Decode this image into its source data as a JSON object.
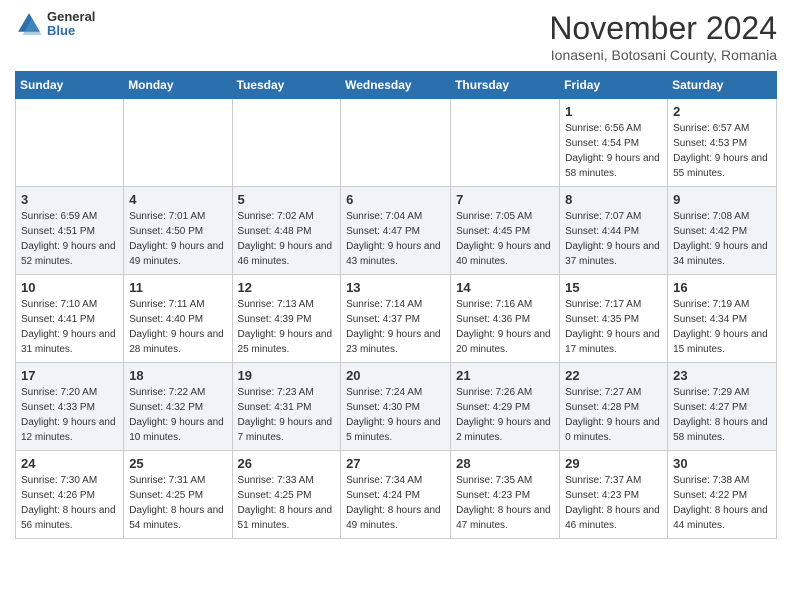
{
  "header": {
    "logo_general": "General",
    "logo_blue": "Blue",
    "month_title": "November 2024",
    "location": "Ionaseni, Botosani County, Romania"
  },
  "days_of_week": [
    "Sunday",
    "Monday",
    "Tuesday",
    "Wednesday",
    "Thursday",
    "Friday",
    "Saturday"
  ],
  "weeks": [
    [
      {
        "day": "",
        "info": ""
      },
      {
        "day": "",
        "info": ""
      },
      {
        "day": "",
        "info": ""
      },
      {
        "day": "",
        "info": ""
      },
      {
        "day": "",
        "info": ""
      },
      {
        "day": "1",
        "info": "Sunrise: 6:56 AM\nSunset: 4:54 PM\nDaylight: 9 hours and 58 minutes."
      },
      {
        "day": "2",
        "info": "Sunrise: 6:57 AM\nSunset: 4:53 PM\nDaylight: 9 hours and 55 minutes."
      }
    ],
    [
      {
        "day": "3",
        "info": "Sunrise: 6:59 AM\nSunset: 4:51 PM\nDaylight: 9 hours and 52 minutes."
      },
      {
        "day": "4",
        "info": "Sunrise: 7:01 AM\nSunset: 4:50 PM\nDaylight: 9 hours and 49 minutes."
      },
      {
        "day": "5",
        "info": "Sunrise: 7:02 AM\nSunset: 4:48 PM\nDaylight: 9 hours and 46 minutes."
      },
      {
        "day": "6",
        "info": "Sunrise: 7:04 AM\nSunset: 4:47 PM\nDaylight: 9 hours and 43 minutes."
      },
      {
        "day": "7",
        "info": "Sunrise: 7:05 AM\nSunset: 4:45 PM\nDaylight: 9 hours and 40 minutes."
      },
      {
        "day": "8",
        "info": "Sunrise: 7:07 AM\nSunset: 4:44 PM\nDaylight: 9 hours and 37 minutes."
      },
      {
        "day": "9",
        "info": "Sunrise: 7:08 AM\nSunset: 4:42 PM\nDaylight: 9 hours and 34 minutes."
      }
    ],
    [
      {
        "day": "10",
        "info": "Sunrise: 7:10 AM\nSunset: 4:41 PM\nDaylight: 9 hours and 31 minutes."
      },
      {
        "day": "11",
        "info": "Sunrise: 7:11 AM\nSunset: 4:40 PM\nDaylight: 9 hours and 28 minutes."
      },
      {
        "day": "12",
        "info": "Sunrise: 7:13 AM\nSunset: 4:39 PM\nDaylight: 9 hours and 25 minutes."
      },
      {
        "day": "13",
        "info": "Sunrise: 7:14 AM\nSunset: 4:37 PM\nDaylight: 9 hours and 23 minutes."
      },
      {
        "day": "14",
        "info": "Sunrise: 7:16 AM\nSunset: 4:36 PM\nDaylight: 9 hours and 20 minutes."
      },
      {
        "day": "15",
        "info": "Sunrise: 7:17 AM\nSunset: 4:35 PM\nDaylight: 9 hours and 17 minutes."
      },
      {
        "day": "16",
        "info": "Sunrise: 7:19 AM\nSunset: 4:34 PM\nDaylight: 9 hours and 15 minutes."
      }
    ],
    [
      {
        "day": "17",
        "info": "Sunrise: 7:20 AM\nSunset: 4:33 PM\nDaylight: 9 hours and 12 minutes."
      },
      {
        "day": "18",
        "info": "Sunrise: 7:22 AM\nSunset: 4:32 PM\nDaylight: 9 hours and 10 minutes."
      },
      {
        "day": "19",
        "info": "Sunrise: 7:23 AM\nSunset: 4:31 PM\nDaylight: 9 hours and 7 minutes."
      },
      {
        "day": "20",
        "info": "Sunrise: 7:24 AM\nSunset: 4:30 PM\nDaylight: 9 hours and 5 minutes."
      },
      {
        "day": "21",
        "info": "Sunrise: 7:26 AM\nSunset: 4:29 PM\nDaylight: 9 hours and 2 minutes."
      },
      {
        "day": "22",
        "info": "Sunrise: 7:27 AM\nSunset: 4:28 PM\nDaylight: 9 hours and 0 minutes."
      },
      {
        "day": "23",
        "info": "Sunrise: 7:29 AM\nSunset: 4:27 PM\nDaylight: 8 hours and 58 minutes."
      }
    ],
    [
      {
        "day": "24",
        "info": "Sunrise: 7:30 AM\nSunset: 4:26 PM\nDaylight: 8 hours and 56 minutes."
      },
      {
        "day": "25",
        "info": "Sunrise: 7:31 AM\nSunset: 4:25 PM\nDaylight: 8 hours and 54 minutes."
      },
      {
        "day": "26",
        "info": "Sunrise: 7:33 AM\nSunset: 4:25 PM\nDaylight: 8 hours and 51 minutes."
      },
      {
        "day": "27",
        "info": "Sunrise: 7:34 AM\nSunset: 4:24 PM\nDaylight: 8 hours and 49 minutes."
      },
      {
        "day": "28",
        "info": "Sunrise: 7:35 AM\nSunset: 4:23 PM\nDaylight: 8 hours and 47 minutes."
      },
      {
        "day": "29",
        "info": "Sunrise: 7:37 AM\nSunset: 4:23 PM\nDaylight: 8 hours and 46 minutes."
      },
      {
        "day": "30",
        "info": "Sunrise: 7:38 AM\nSunset: 4:22 PM\nDaylight: 8 hours and 44 minutes."
      }
    ]
  ]
}
